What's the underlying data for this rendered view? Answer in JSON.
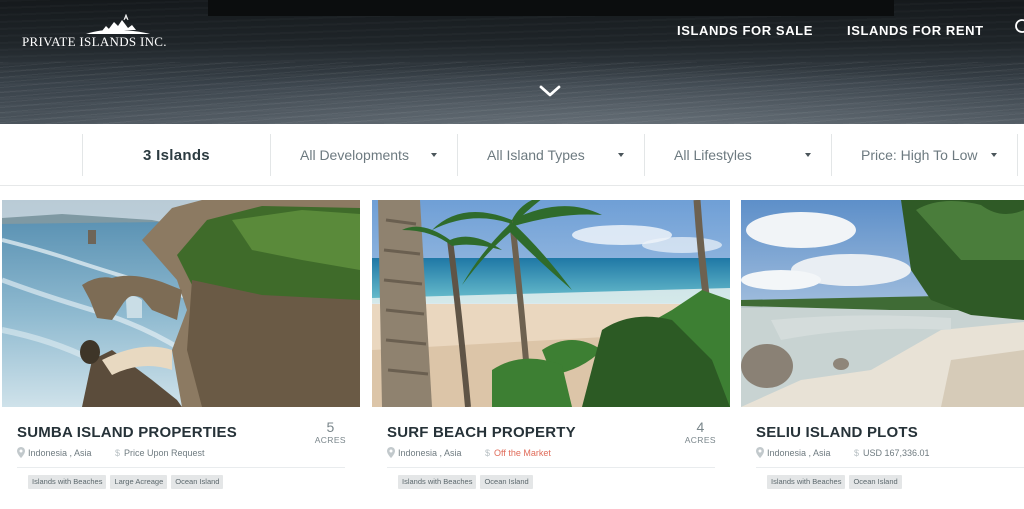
{
  "header": {
    "logo_text": "PRIVATE ISLANDS INC.",
    "nav": [
      {
        "label": "ISLANDS FOR SALE"
      },
      {
        "label": "ISLANDS FOR RENT"
      }
    ]
  },
  "filters": {
    "count_label": "3 Islands",
    "developments": "All Developments",
    "island_types": "All Island Types",
    "lifestyles": "All Lifestyles",
    "sort": "Price: High To Low"
  },
  "cards": [
    {
      "title": "SUMBA ISLAND PROPERTIES",
      "acres_value": "5",
      "acres_label": "ACRES",
      "location": "Indonesia , Asia",
      "price": "Price Upon Request",
      "price_status": "normal",
      "tags": [
        "Islands with Beaches",
        "Large Acreage",
        "Ocean Island"
      ]
    },
    {
      "title": "SURF BEACH PROPERTY",
      "acres_value": "4",
      "acres_label": "ACRES",
      "location": "Indonesia , Asia",
      "price": "Off the Market",
      "price_status": "off-market",
      "tags": [
        "Islands with Beaches",
        "Ocean Island"
      ]
    },
    {
      "title": "SELIU ISLAND PLOTS",
      "location": "Indonesia , Asia",
      "price": "USD 167,336.01",
      "price_status": "normal",
      "tags": [
        "Islands with Beaches",
        "Ocean Island"
      ]
    }
  ],
  "colors": {
    "off_market": "#e06c5a",
    "tag_bg": "#e4e6e7",
    "text_dark": "#263238"
  }
}
